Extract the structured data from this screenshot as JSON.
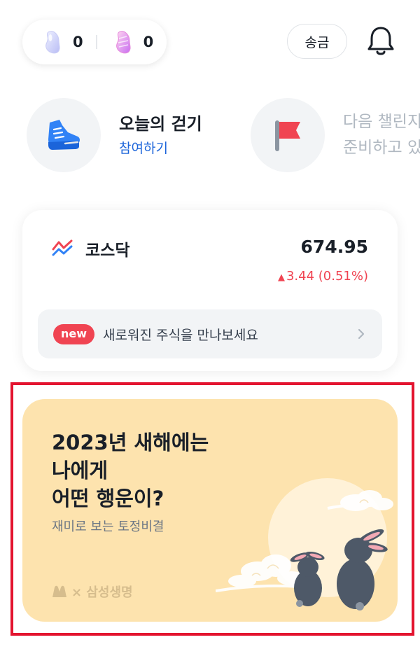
{
  "topbar": {
    "points": [
      {
        "icon": "jelly-bean-purple-icon",
        "count": "0"
      },
      {
        "icon": "jelly-bean-pink-icon",
        "count": "0"
      }
    ],
    "send_label": "송금"
  },
  "challenges": [
    {
      "title": "오늘의 걷기",
      "action": "참여하기"
    },
    {
      "title_line1": "다음 챌린지",
      "title_line2": "준비하고 있어요"
    }
  ],
  "index_card": {
    "name": "코스닥",
    "value": "674.95",
    "change": "3.44 (0.51%)",
    "banner_badge": "new",
    "banner_text": "새로워진 주식을 만나보세요"
  },
  "fortune_card": {
    "title_lines": [
      "2023년 새해에는",
      "나에게",
      "어떤 행운이?"
    ],
    "subtitle": "재미로 보는 토정비결",
    "brand": "× 삼성생명"
  },
  "colors": {
    "accent_blue": "#1b64da",
    "rise_red": "#f04452",
    "card_yellow": "#fde3ae",
    "highlight_red": "#e3142f"
  }
}
